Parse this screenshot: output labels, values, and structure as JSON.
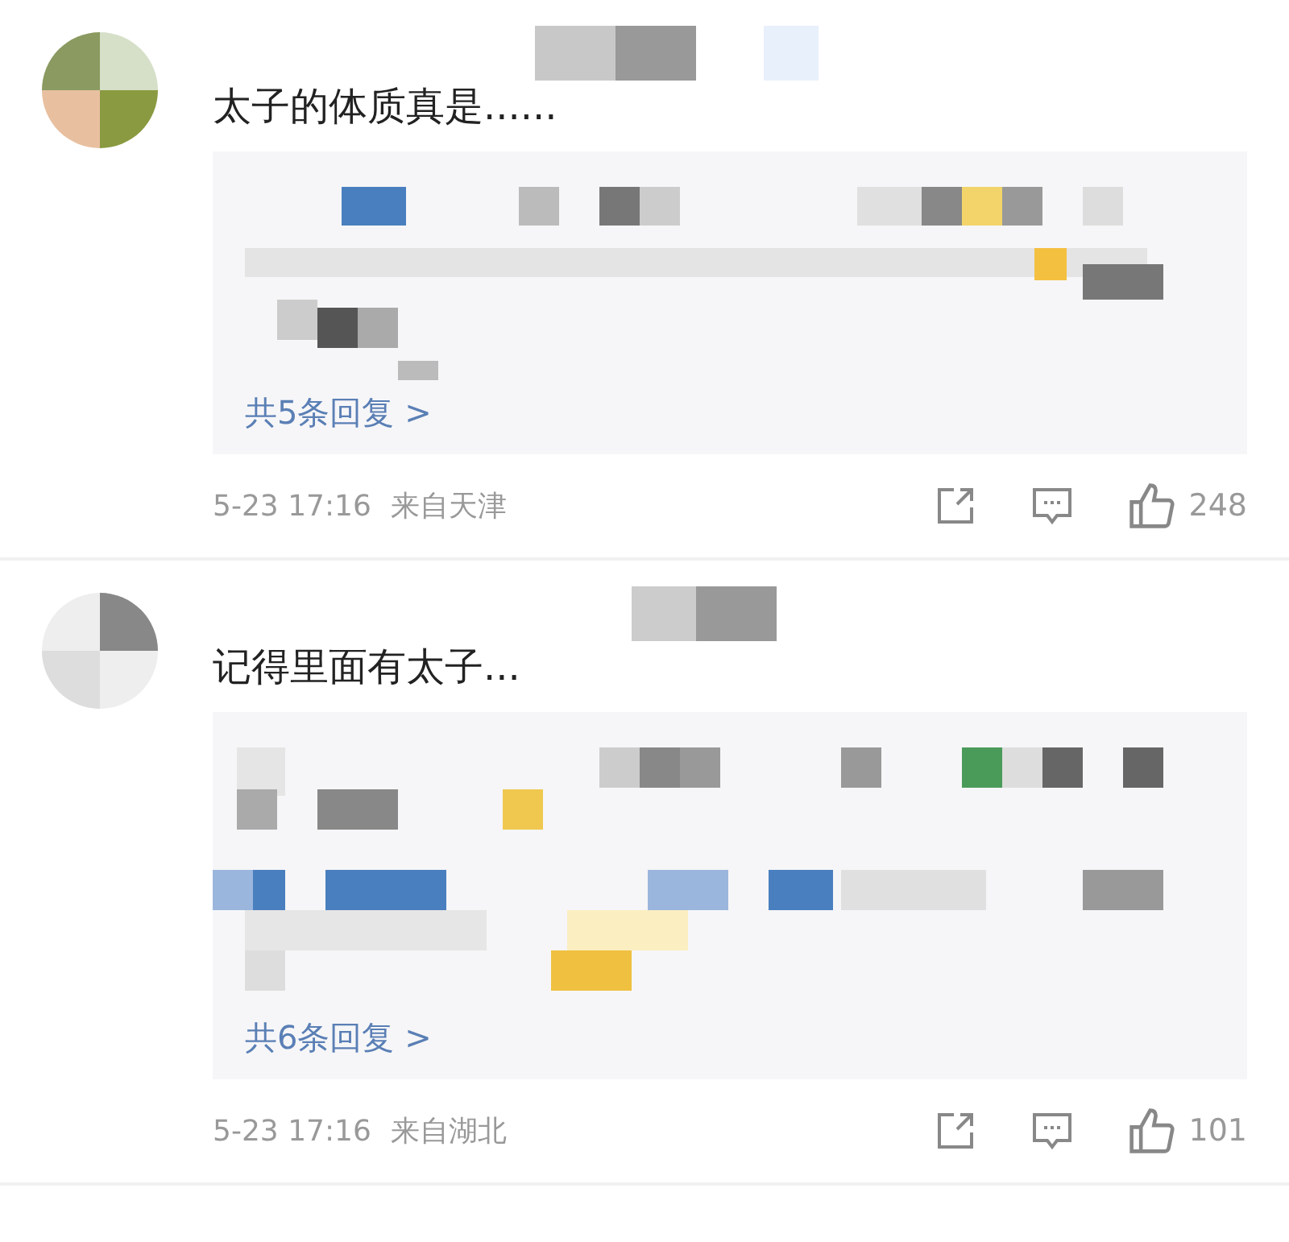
{
  "comments": [
    {
      "text": "太子的体质真是......",
      "replies_link": "共5条回复 >",
      "time": "5-23 17:16",
      "location": "来自天津",
      "likes": "248"
    },
    {
      "text": "记得里面有太子...",
      "replies_link": "共6条回复 >",
      "time": "5-23 17:16",
      "location": "来自湖北",
      "likes": "101"
    }
  ]
}
